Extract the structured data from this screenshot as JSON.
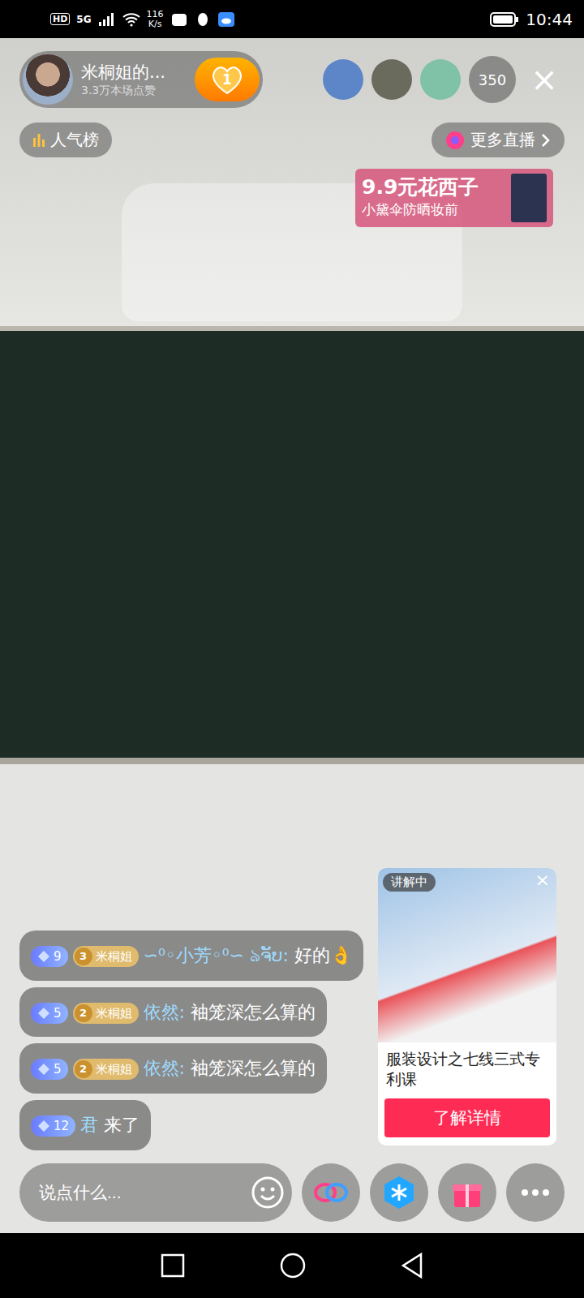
{
  "status_bar": {
    "badges": [
      "HD",
      "5G"
    ],
    "speed": "116",
    "speed_unit": "K/s",
    "time": "10:44"
  },
  "host": {
    "name": "米桐姐的...",
    "likes": "3.3万本场点赞",
    "follow_count": "1"
  },
  "viewers": {
    "count": "350",
    "close": "×"
  },
  "rank_button": "人气榜",
  "more_live": "更多直播",
  "ad": {
    "title": "9.9元花西子",
    "subtitle": "小黛伞防晒妆前"
  },
  "comments": [
    {
      "level": "9",
      "fan_level": "3",
      "fan_name": "米桐姐",
      "user": "∽⁰◦小芳◦⁰∽ ঌຈັບ:",
      "text": "好的👌"
    },
    {
      "level": "5",
      "fan_level": "2",
      "fan_name": "米桐姐",
      "user": "依然:",
      "text": "袖笼深怎么算的"
    },
    {
      "level": "5",
      "fan_level": "2",
      "fan_name": "米桐姐",
      "user": "依然:",
      "text": "袖笼深怎么算的"
    },
    {
      "level": "12",
      "user": "君",
      "text": "来了"
    }
  ],
  "input": {
    "placeholder": "说点什么..."
  },
  "product": {
    "badge": "讲解中",
    "close": "×",
    "title": "服装设计之七线三式专利课",
    "button": "了解详情"
  }
}
